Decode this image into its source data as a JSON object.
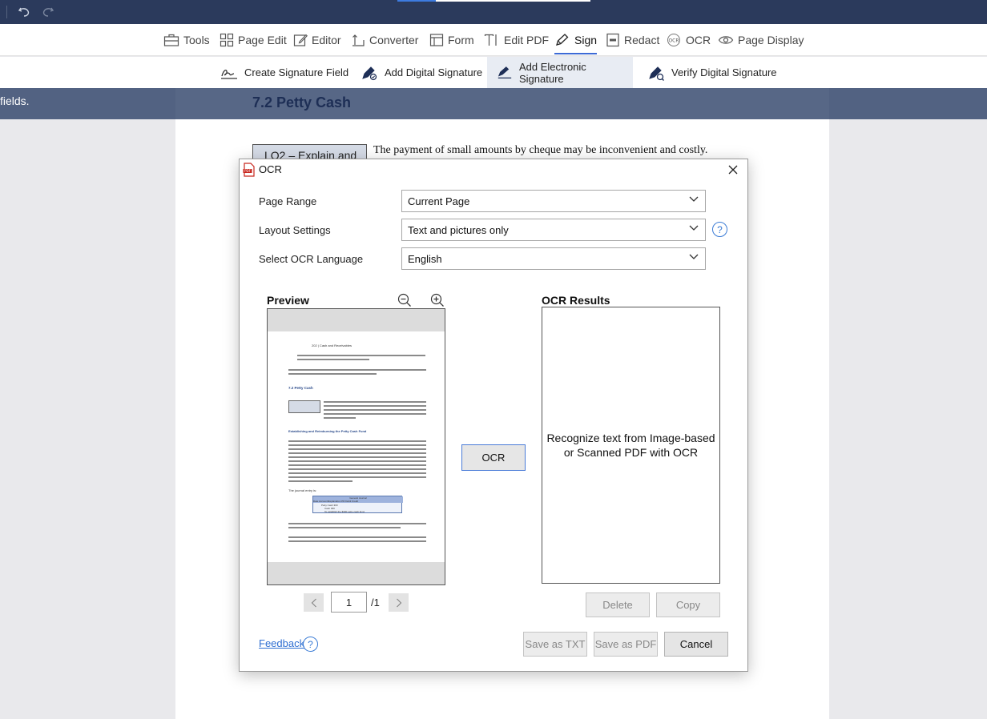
{
  "toolbar": {
    "items": [
      {
        "label": "Tools",
        "icon": "toolbox-icon"
      },
      {
        "label": "Page Edit",
        "icon": "grid-icon"
      },
      {
        "label": "Editor",
        "icon": "pencil-icon"
      },
      {
        "label": "Converter",
        "icon": "convert-icon"
      },
      {
        "label": "Form",
        "icon": "form-icon"
      },
      {
        "label": "Edit PDF",
        "icon": "text-cursor-icon"
      },
      {
        "label": "Sign",
        "icon": "pen-icon"
      },
      {
        "label": "Redact",
        "icon": "redact-icon"
      },
      {
        "label": "OCR",
        "icon": "ocr-icon"
      },
      {
        "label": "Page Display",
        "icon": "eye-icon"
      }
    ],
    "active": "Sign"
  },
  "subtoolbar": {
    "items": [
      {
        "label": "Create Signature Field"
      },
      {
        "label": "Add Digital Signature"
      },
      {
        "label": "Add Electronic Signature"
      },
      {
        "label": "Verify Digital Signature"
      }
    ],
    "active": "Add Electronic Signature"
  },
  "document": {
    "hint_text": "fields.",
    "section_heading": "7.2   Petty Cash",
    "lo_box": "LO2 – Explain and",
    "first_line": "The payment of small amounts by cheque may be inconvenient and costly."
  },
  "dialog": {
    "title": "OCR",
    "fields": {
      "page_range": {
        "label": "Page Range",
        "value": "Current Page"
      },
      "layout": {
        "label": "Layout Settings",
        "value": "Text and pictures only"
      },
      "language": {
        "label": "Select OCR Language",
        "value": "English"
      }
    },
    "help_symbol": "?",
    "preview_heading": "Preview",
    "results_heading": "OCR Results",
    "results_placeholder": "Recognize text from Image-based or Scanned PDF with OCR",
    "ocr_button": "OCR",
    "page_current": "1",
    "page_total": "/1",
    "delete_label": "Delete",
    "copy_label": "Copy",
    "feedback_label": "Feedback",
    "save_txt_label": "Save as TXT",
    "save_pdf_label": "Save as PDF",
    "cancel_label": "Cancel",
    "thumbnail": {
      "header": "202  |  Cash and Receivables",
      "heading": "7.2    Petty Cash",
      "subheading": "Establishing and Reimbursing the Petty Cash Fund",
      "journal_intro": "The journal entry is:",
      "table_title": "General Journal",
      "table_cols": "Date   Account/Explanation   PR   Debit   Credit",
      "row1": "Petty Cash                    300",
      "row2": "Cash                                 300",
      "row3": "To establish the $300 petty cash fund."
    }
  },
  "colors": {
    "titlebar": "#2b3a5c",
    "accent": "#3d6ad6",
    "link": "#2f6fd2",
    "heading": "#1d2e55"
  }
}
